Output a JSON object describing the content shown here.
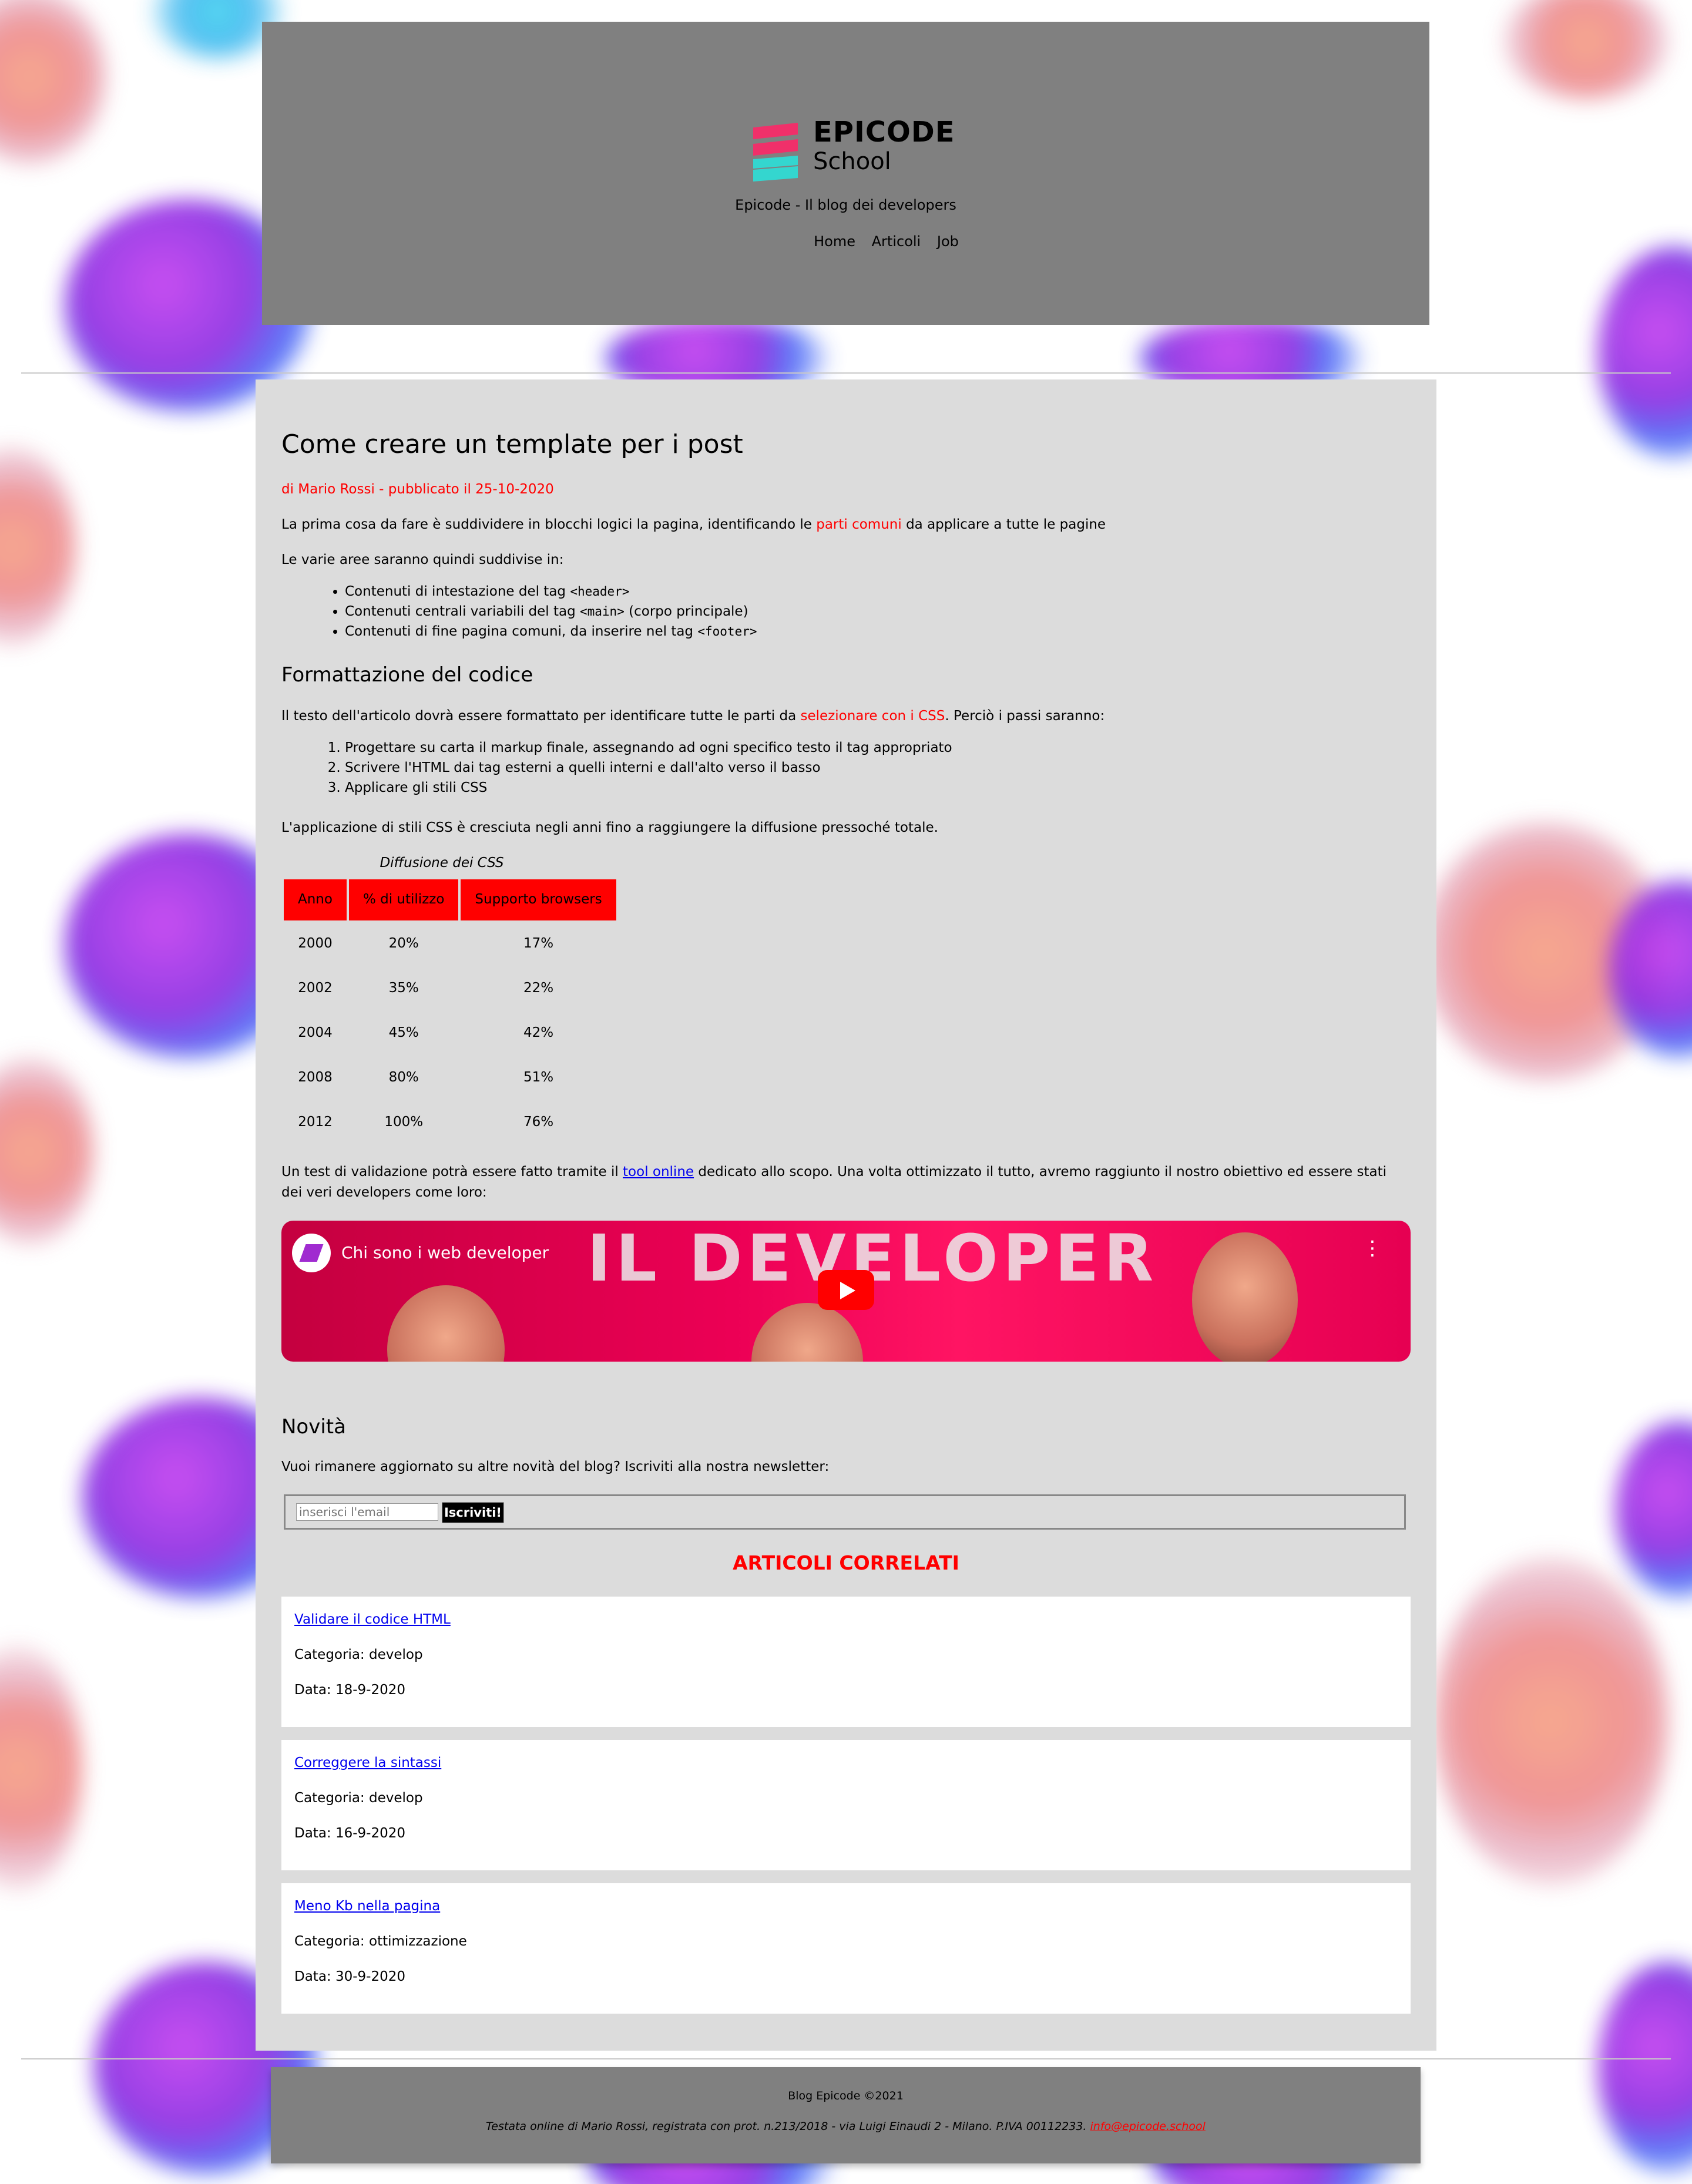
{
  "header": {
    "logo_brand": "EPICODE",
    "logo_sub": "School",
    "tagline": "Epicode - Il blog dei developers",
    "nav": [
      "Home",
      "Articoli",
      "Job"
    ]
  },
  "article": {
    "title": "Come creare un template per i post",
    "byline": "di Mario Rossi - pubblicato il 25-10-2020",
    "p1_pre": "La prima cosa da fare è suddividere in blocchi logici la pagina, identificando le ",
    "p1_red": "parti comuni",
    "p1_post": " da applicare a tutte le pagine",
    "p2": "Le varie aree saranno quindi suddivise in:",
    "list": [
      {
        "pre": "Contenuti di intestazione del tag ",
        "code": "<header>",
        "post": ""
      },
      {
        "pre": "Contenuti centrali variabili del tag ",
        "code": "<main>",
        "post": " (corpo principale)"
      },
      {
        "pre": "Contenuti di fine pagina comuni, da inserire nel tag ",
        "code": "<footer>",
        "post": ""
      }
    ],
    "h2": "Formattazione del codice",
    "p3_pre": "Il testo dell'articolo dovrà essere formattato per identificare tutte le parti da ",
    "p3_red": "selezionare con i CSS",
    "p3_post": ". Perciò i passi saranno:",
    "steps": [
      "Progettare su carta il markup finale, assegnando ad ogni specifico testo il tag appropriato",
      "Scrivere l'HTML dai tag esterni a quelli interni e dall'alto verso il basso",
      "Applicare gli stili CSS"
    ],
    "p4": "L'applicazione di stili CSS è cresciuta negli anni fino a raggiungere la diffusione pressoché totale.",
    "table": {
      "caption": "Diffusione dei CSS",
      "headers": [
        "Anno",
        "% di utilizzo",
        "Supporto browsers"
      ],
      "rows": [
        [
          "2000",
          "20%",
          "17%"
        ],
        [
          "2002",
          "35%",
          "22%"
        ],
        [
          "2004",
          "45%",
          "42%"
        ],
        [
          "2008",
          "80%",
          "51%"
        ],
        [
          "2012",
          "100%",
          "76%"
        ]
      ]
    },
    "p5_pre": "Un test di validazione potrà essere fatto tramite il ",
    "p5_link": "tool online",
    "p5_post": " dedicato allo scopo. Una volta ottimizzato il tutto, avremo raggiunto il nostro obiettivo ed essere stati dei veri developers come loro:",
    "video": {
      "title": "Chi sono i web developer",
      "banner_text": "IL DEVELOPER"
    }
  },
  "news": {
    "title": "Novità",
    "text": "Vuoi rimanere aggiornato su altre novità del blog? Iscriviti alla nostra newsletter:",
    "input_placeholder": "inserisci l'email",
    "button": "Iscriviti!"
  },
  "related": {
    "title": "ARTICOLI CORRELATI",
    "items": [
      {
        "link": "Validare il codice HTML",
        "category": "Categoria: develop",
        "date": "Data: 18-9-2020"
      },
      {
        "link": "Correggere la sintassi",
        "category": "Categoria: develop",
        "date": "Data: 16-9-2020"
      },
      {
        "link": "Meno Kb nella pagina",
        "category": "Categoria: ottimizzazione",
        "date": "Data: 30-9-2020"
      }
    ]
  },
  "footer": {
    "copyright": "Blog Epicode ©2021",
    "legal": "Testata online di Mario Rossi, registrata con prot. n.213/2018 - via Luigi Einaudi 2 - Milano. P.IVA 00112233. ",
    "email": "info@epicode.school"
  },
  "colors": {
    "accent_red": "#ff0000",
    "header_gray": "#808080",
    "content_gray": "#dcdcdc",
    "link_blue": "#0000ee"
  }
}
